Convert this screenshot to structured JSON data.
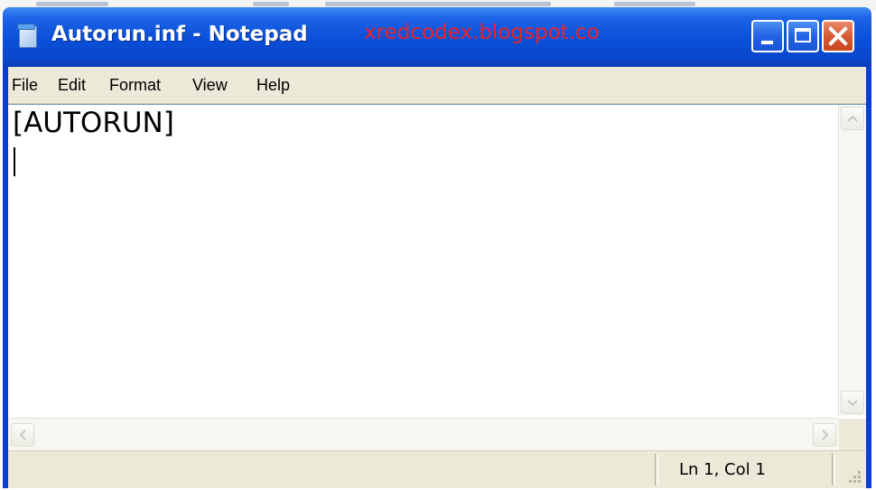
{
  "window": {
    "title": "Autorun.inf - Notepad",
    "watermark": "xredcodex.blogspot.co",
    "title_color": "#0a4fd8",
    "close_color": "#d65a35"
  },
  "icons": {
    "app": "notepad-icon",
    "minimize": "minimize-icon",
    "maximize": "maximize-icon",
    "close": "close-icon",
    "scroll_up": "arrow-up-icon",
    "scroll_down": "arrow-down-icon",
    "scroll_left": "arrow-left-icon",
    "scroll_right": "arrow-right-icon",
    "grip": "resize-grip-icon"
  },
  "menu": {
    "items": [
      "File",
      "Edit",
      "Format",
      "View",
      "Help"
    ]
  },
  "editor": {
    "content": "[AUTORUN]"
  },
  "status": {
    "position": "Ln 1, Col 1"
  }
}
